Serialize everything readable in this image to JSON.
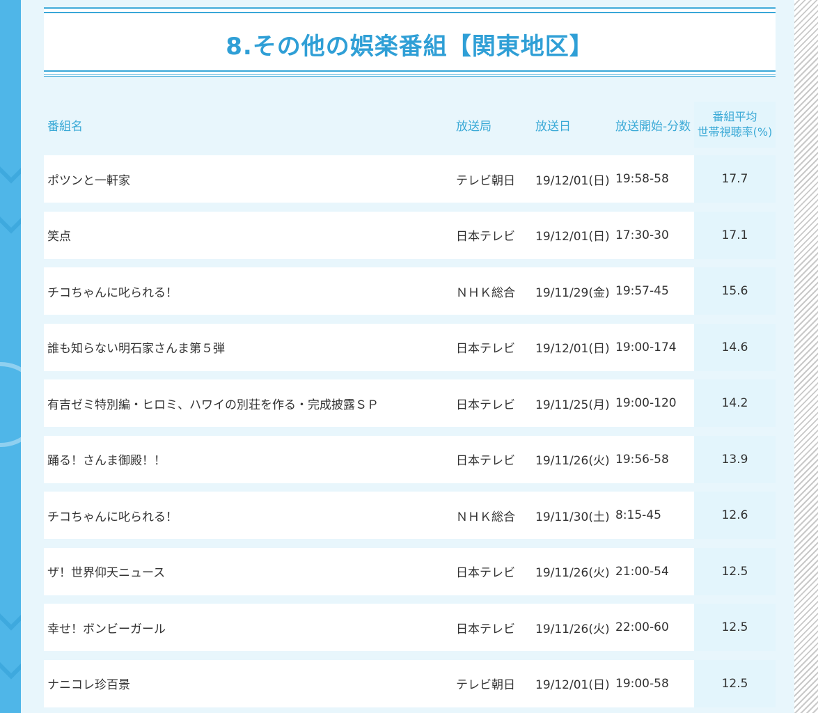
{
  "section": {
    "title": "8.その他の娯楽番組【関東地区】"
  },
  "table": {
    "headers": {
      "name": "番組名",
      "station": "放送局",
      "date": "放送日",
      "time": "放送開始-分数",
      "rating_line1": "番組平均",
      "rating_line2": "世帯視聴率(%)"
    },
    "rows": [
      {
        "name": "ポツンと一軒家",
        "station": "テレビ朝日",
        "date": "19/12/01(日)",
        "time": "19:58-58",
        "rating": "17.7"
      },
      {
        "name": "笑点",
        "station": "日本テレビ",
        "date": "19/12/01(日)",
        "time": "17:30-30",
        "rating": "17.1"
      },
      {
        "name": "チコちゃんに叱られる！",
        "station": "ＮＨＫ総合",
        "date": "19/11/29(金)",
        "time": "19:57-45",
        "rating": "15.6"
      },
      {
        "name": "誰も知らない明石家さんま第５弾",
        "station": "日本テレビ",
        "date": "19/12/01(日)",
        "time": "19:00-174",
        "rating": "14.6"
      },
      {
        "name": "有吉ゼミ特別編・ヒロミ、ハワイの別荘を作る・完成披露ＳＰ",
        "station": "日本テレビ",
        "date": "19/11/25(月)",
        "time": "19:00-120",
        "rating": "14.2"
      },
      {
        "name": "踊る！さんま御殿！！",
        "station": "日本テレビ",
        "date": "19/11/26(火)",
        "time": "19:56-58",
        "rating": "13.9"
      },
      {
        "name": "チコちゃんに叱られる！",
        "station": "ＮＨＫ総合",
        "date": "19/11/30(土)",
        "time": "8:15-45",
        "rating": "12.6"
      },
      {
        "name": "ザ！世界仰天ニュース",
        "station": "日本テレビ",
        "date": "19/11/26(火)",
        "time": "21:00-54",
        "rating": "12.5"
      },
      {
        "name": "幸せ！ボンビーガール",
        "station": "日本テレビ",
        "date": "19/11/26(火)",
        "time": "22:00-60",
        "rating": "12.5"
      },
      {
        "name": "ナニコレ珍百景",
        "station": "テレビ朝日",
        "date": "19/12/01(日)",
        "time": "19:00-58",
        "rating": "12.5"
      }
    ]
  },
  "colors": {
    "accent": "#2f9fd6",
    "header_text": "#3aa9d6",
    "rating_bg": "#e3f5fc",
    "left_band": "#4fb6e8"
  }
}
